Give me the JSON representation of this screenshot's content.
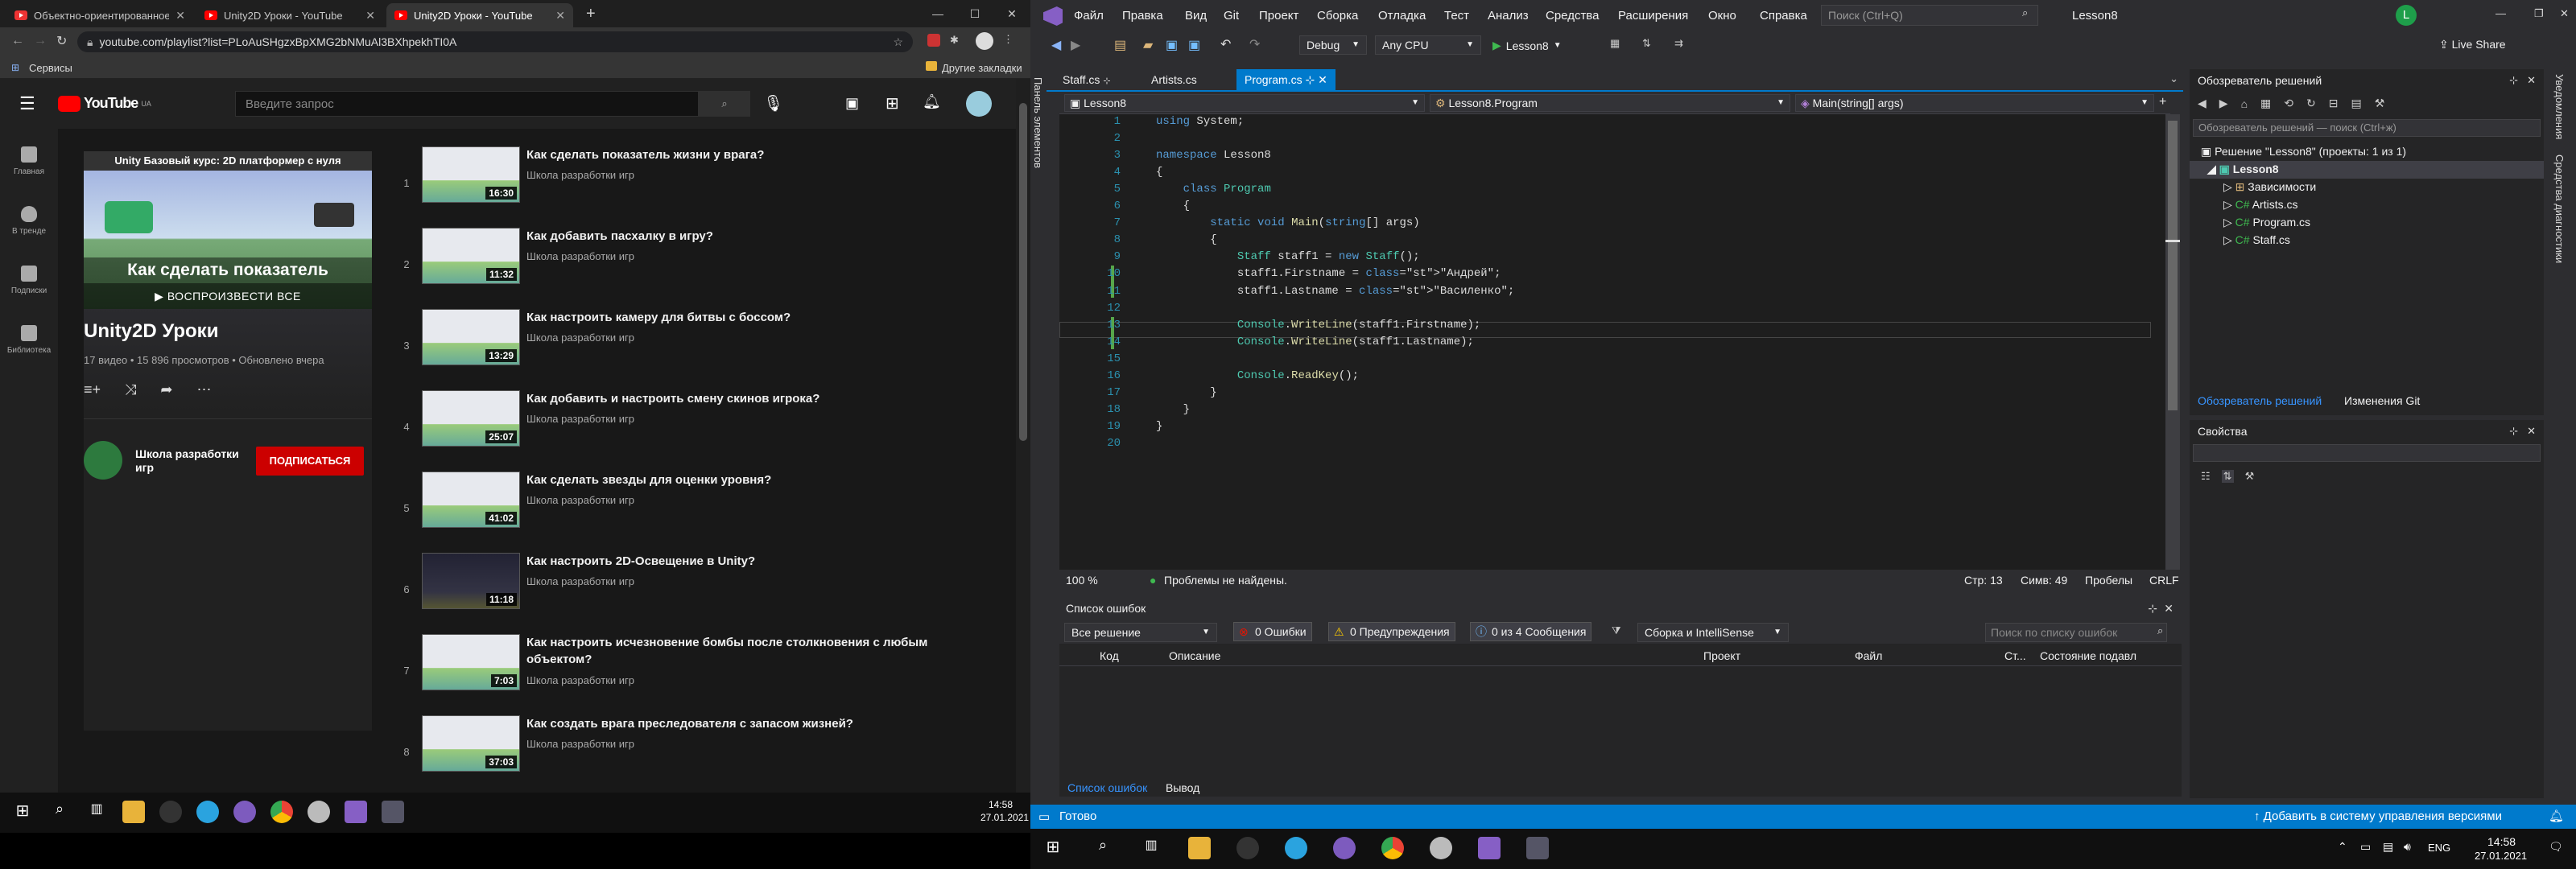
{
  "chrome": {
    "tabs": [
      {
        "title": "Объектно-ориентированное пр",
        "active": false
      },
      {
        "title": "Unity2D Уроки - YouTube",
        "active": false
      },
      {
        "title": "Unity2D Уроки - YouTube",
        "active": true
      }
    ],
    "new_tab": "+",
    "url": "youtube.com/playlist?list=PLoAuSHgzxBpXMG2bNMuAl3BXhpekhTI0A",
    "bookmarks_apps": "Сервисы",
    "bookmarks_other": "Другие закладки"
  },
  "youtube": {
    "logo": "YouTube",
    "logo_region": "UA",
    "search_placeholder": "Введите запрос",
    "sidebar": [
      {
        "label": "Главная"
      },
      {
        "label": "В тренде"
      },
      {
        "label": "Подписки"
      },
      {
        "label": "Библиотека"
      }
    ],
    "playlist": {
      "thumb_title": "Unity Базовый курс: 2D платформер с нуля",
      "thumb_caption": "Как сделать показатель",
      "play_all": "▶ ВОСПРОИЗВЕСТИ ВСЕ",
      "title": "Unity2D Уроки",
      "meta": "17 видео • 15 896 просмотров • Обновлено вчера",
      "channel": "Школа разработки игр",
      "subscribe": "ПОДПИСАТЬСЯ"
    },
    "videos": [
      {
        "n": "1",
        "title": "Как сделать показатель жизни у врага?",
        "channel": "Школа разработки игр",
        "duration": "16:30"
      },
      {
        "n": "2",
        "title": "Как добавить пасхалку в игру?",
        "channel": "Школа разработки игр",
        "duration": "11:32"
      },
      {
        "n": "3",
        "title": "Как настроить камеру для битвы с боссом?",
        "channel": "Школа разработки игр",
        "duration": "13:29"
      },
      {
        "n": "4",
        "title": "Как добавить и настроить смену скинов игрока?",
        "channel": "Школа разработки игр",
        "duration": "25:07"
      },
      {
        "n": "5",
        "title": "Как сделать звезды для оценки уровня?",
        "channel": "Школа разработки игр",
        "duration": "41:02"
      },
      {
        "n": "6",
        "title": "Как настроить 2D-Освещение в Unity?",
        "channel": "Школа разработки игр",
        "duration": "11:18"
      },
      {
        "n": "7",
        "title": "Как настроить исчезновение бомбы после столкновения с любым объектом?",
        "channel": "Школа разработки игр",
        "duration": "7:03"
      },
      {
        "n": "8",
        "title": "Как создать врага преследователя с запасом жизней?",
        "channel": "Школа разработки игр",
        "duration": "37:03"
      }
    ]
  },
  "taskbar_left": {
    "time": "14:58",
    "date": "27.01.2021"
  },
  "vs": {
    "menu": [
      "Файл",
      "Правка",
      "Вид",
      "Git",
      "Проект",
      "Сборка",
      "Отладка",
      "Тест",
      "Анализ",
      "Средства",
      "Расширения",
      "Окно",
      "Справка"
    ],
    "search_placeholder": "Поиск (Ctrl+Q)",
    "solution_name": "Lesson8",
    "user_initial": "L",
    "config": "Debug",
    "platform": "Any CPU",
    "run_label": "Lesson8",
    "live_share": "Live Share",
    "tabs": [
      {
        "label": "Staff.cs",
        "active": false
      },
      {
        "label": "Artists.cs",
        "active": false
      },
      {
        "label": "Program.cs",
        "active": true
      }
    ],
    "nav": {
      "project": "Lesson8",
      "class": "Lesson8.Program",
      "member": "Main(string[] args)"
    },
    "code_lines": [
      "using System;",
      "",
      "namespace Lesson8",
      "{",
      "    class Program",
      "    {",
      "        static void Main(string[] args)",
      "        {",
      "            Staff staff1 = new Staff();",
      "            staff1.Firstname = \"Андрей\";",
      "            staff1.Lastname = \"Василенко\";",
      "",
      "            Console.WriteLine(staff1.Firstname);",
      "            Console.WriteLine(staff1.Lastname);",
      "",
      "            Console.ReadKey();",
      "        }",
      "    }",
      "}",
      ""
    ],
    "editor_status": {
      "zoom": "100 %",
      "issues": "Проблемы не найдены.",
      "line": "Стр: 13",
      "col": "Симв: 49",
      "ws": "Пробелы",
      "eol": "CRLF"
    },
    "error_list": {
      "title": "Список ошибок",
      "scope": "Все решение",
      "errors": "0 Ошибки",
      "warnings": "0 Предупреждения",
      "messages": "0 из 4 Сообщения",
      "build": "Сборка и IntelliSense",
      "search_placeholder": "Поиск по списку ошибок",
      "columns": [
        "Код",
        "Описание",
        "Проект",
        "Файл",
        "Ст...",
        "Состояние подавл"
      ]
    },
    "bottom_tabs": [
      "Список ошибок",
      "Вывод"
    ],
    "solution_explorer": {
      "title": "Обозреватель решений",
      "search_placeholder": "Обозреватель решений — поиск (Ctrl+ж)",
      "root": "Решение \"Lesson8\" (проекты: 1 из 1)",
      "project": "Lesson8",
      "items": [
        "Зависимости",
        "Artists.cs",
        "Program.cs",
        "Staff.cs"
      ],
      "tab_solution": "Обозреватель решений",
      "tab_git": "Изменения Git"
    },
    "properties_title": "Свойства",
    "right_side": [
      "Уведомления",
      "Средства диагностики"
    ],
    "left_side": "Панель элементов",
    "status_ready": "Готово",
    "status_vcs": "↑ Добавить в систему управления версиями"
  },
  "taskbar_right": {
    "lang": "ENG",
    "time": "14:58",
    "date": "27.01.2021"
  }
}
